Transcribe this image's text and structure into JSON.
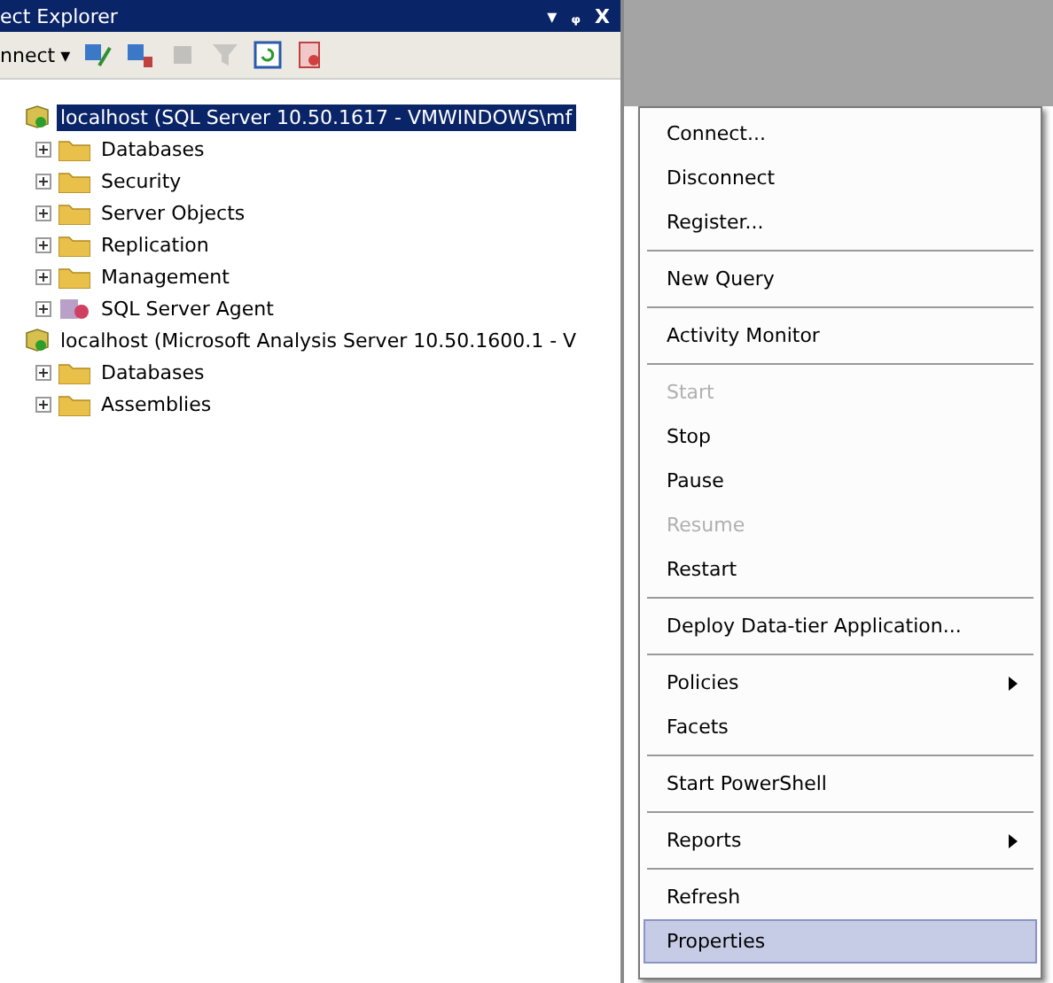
{
  "window": {
    "title": "ect Explorer",
    "buttons": [
      "▾",
      "ᵩ",
      "X"
    ]
  },
  "toolbar": {
    "connect": "nnect",
    "caret": "▾",
    "icons": [
      {
        "kind": "connect",
        "disabled": false
      },
      {
        "kind": "disconnect",
        "disabled": false
      },
      {
        "kind": "stop",
        "disabled": true
      },
      {
        "kind": "filter",
        "disabled": true
      },
      {
        "kind": "refresh",
        "disabled": false
      },
      {
        "kind": "activity",
        "disabled": false
      }
    ]
  },
  "tree": [
    {
      "label": "localhost (SQL Server 10.50.1617 - VMWINDOWS\\mf",
      "kind": "server",
      "selected": true,
      "children": [
        {
          "label": "Databases",
          "kind": "folder",
          "selected": false
        },
        {
          "label": "Security",
          "kind": "folder",
          "selected": false
        },
        {
          "label": "Server Objects",
          "kind": "folder",
          "selected": false
        },
        {
          "label": "Replication",
          "kind": "folder",
          "selected": false
        },
        {
          "label": "Management",
          "kind": "folder",
          "selected": false
        },
        {
          "label": "SQL Server Agent",
          "kind": "agent",
          "selected": false
        }
      ]
    },
    {
      "label": "localhost (Microsoft Analysis Server 10.50.1600.1 - V",
      "kind": "server",
      "selected": false,
      "children": [
        {
          "label": "Databases",
          "kind": "folder",
          "selected": false
        },
        {
          "label": "Assemblies",
          "kind": "folder",
          "selected": false
        }
      ]
    }
  ],
  "context_menu": [
    {
      "kind": "item",
      "label": "Connect...",
      "disabled": false,
      "selected": false,
      "submenu": false
    },
    {
      "kind": "item",
      "label": "Disconnect",
      "disabled": false,
      "selected": false,
      "submenu": false
    },
    {
      "kind": "item",
      "label": "Register...",
      "disabled": false,
      "selected": false,
      "submenu": false
    },
    {
      "kind": "separator"
    },
    {
      "kind": "item",
      "label": "New Query",
      "disabled": false,
      "selected": false,
      "submenu": false
    },
    {
      "kind": "separator"
    },
    {
      "kind": "item",
      "label": "Activity Monitor",
      "disabled": false,
      "selected": false,
      "submenu": false
    },
    {
      "kind": "separator"
    },
    {
      "kind": "item",
      "label": "Start",
      "disabled": true,
      "selected": false,
      "submenu": false
    },
    {
      "kind": "item",
      "label": "Stop",
      "disabled": false,
      "selected": false,
      "submenu": false
    },
    {
      "kind": "item",
      "label": "Pause",
      "disabled": false,
      "selected": false,
      "submenu": false
    },
    {
      "kind": "item",
      "label": "Resume",
      "disabled": true,
      "selected": false,
      "submenu": false
    },
    {
      "kind": "item",
      "label": "Restart",
      "disabled": false,
      "selected": false,
      "submenu": false
    },
    {
      "kind": "separator"
    },
    {
      "kind": "item",
      "label": "Deploy Data-tier Application...",
      "disabled": false,
      "selected": false,
      "submenu": false
    },
    {
      "kind": "separator"
    },
    {
      "kind": "item",
      "label": "Policies",
      "disabled": false,
      "selected": false,
      "submenu": true
    },
    {
      "kind": "item",
      "label": "Facets",
      "disabled": false,
      "selected": false,
      "submenu": false
    },
    {
      "kind": "separator"
    },
    {
      "kind": "item",
      "label": "Start PowerShell",
      "disabled": false,
      "selected": false,
      "submenu": false
    },
    {
      "kind": "separator"
    },
    {
      "kind": "item",
      "label": "Reports",
      "disabled": false,
      "selected": false,
      "submenu": true
    },
    {
      "kind": "separator"
    },
    {
      "kind": "item",
      "label": "Refresh",
      "disabled": false,
      "selected": false,
      "submenu": false
    },
    {
      "kind": "item",
      "label": "Properties",
      "disabled": false,
      "selected": true,
      "submenu": false
    }
  ]
}
